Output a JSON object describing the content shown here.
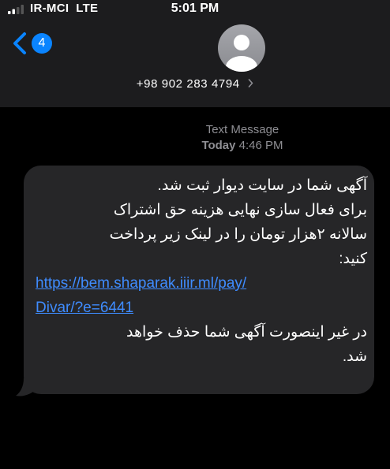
{
  "status_bar": {
    "carrier": "IR-MCI",
    "network": "LTE",
    "time": "5:01 PM"
  },
  "header": {
    "back_badge": "4",
    "contact_number": "+98 902 283 4794",
    "icons": [
      "chevron-left-icon",
      "person-avatar-icon",
      "chevron-right-icon",
      "signal-bars-icon"
    ],
    "accent_color": "#0a84ff"
  },
  "conversation": {
    "type_label": "Text Message",
    "day_label": "Today",
    "time_label": "4:46 PM"
  },
  "message": {
    "line1": "آگهی شما در سایت دیوار ثبت شد.",
    "line2": "برای فعال سازی نهایی هزینه حق اشتراک",
    "line3": "سالانه ۲هزار تومان را در لینک زیر پرداخت",
    "line4": "کنید:",
    "link_line1": "https://bem.shaparak.iiir.ml/pay/",
    "link_line2": "Divar/?e=6441",
    "line7": "در غیر اینصورت آگهی شما حذف خواهد",
    "line8": "شد.",
    "link_color": "#3f8cff",
    "bubble_color": "#262628"
  }
}
